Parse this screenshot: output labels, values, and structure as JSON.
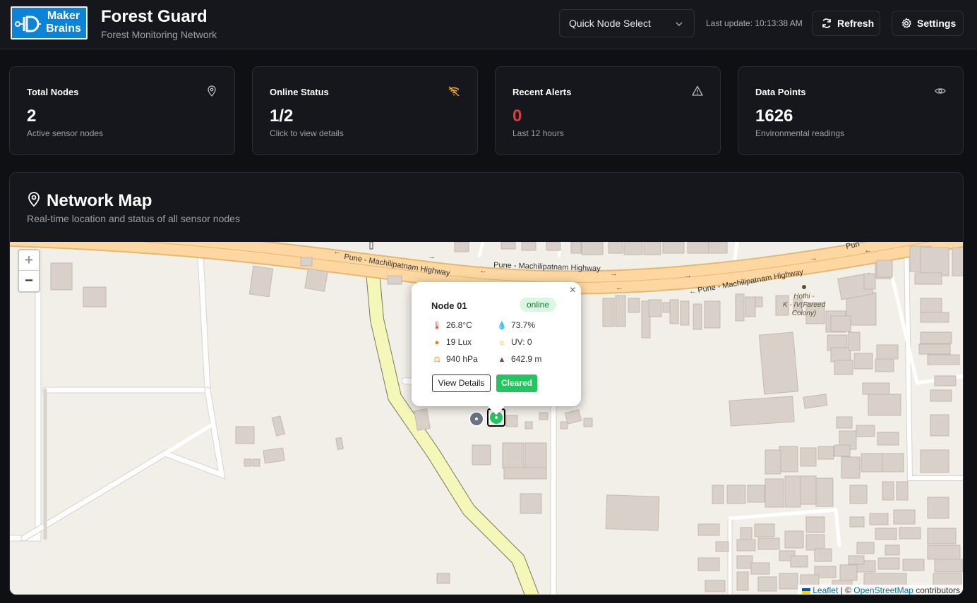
{
  "header": {
    "logo_line1": "Maker",
    "logo_line2": "Brains",
    "title": "Forest Guard",
    "subtitle": "Forest Monitoring Network",
    "quick_select": "Quick Node Select",
    "last_update": "Last update: 10:13:38 AM",
    "refresh_label": "Refresh",
    "settings_label": "Settings"
  },
  "cards": [
    {
      "title": "Total Nodes",
      "value": "2",
      "sub": "Active sensor nodes",
      "icon": "map-pin-icon"
    },
    {
      "title": "Online Status",
      "value": "1/2",
      "sub": "Click to view details",
      "icon": "wifi-off-icon"
    },
    {
      "title": "Recent Alerts",
      "value": "0",
      "sub": "Last 12 hours",
      "icon": "warning-icon"
    },
    {
      "title": "Data Points",
      "value": "1626",
      "sub": "Environmental readings",
      "icon": "eye-icon"
    }
  ],
  "colors": {
    "accent_warn": "#f5a623",
    "alert_value": "#e5393b",
    "online_green": "#22c55e",
    "offline_gray": "#6b7280",
    "logo_blue": "#0b83d9"
  },
  "map_section": {
    "title": "Network Map",
    "subtitle": "Real-time location and status of all sensor nodes",
    "zoom_in": "+",
    "zoom_out": "−",
    "roads": [
      "Pune - Machilipatnam Highway"
    ],
    "place_label": [
      "Hothi -",
      "K - IV(Fareed",
      "Colony)"
    ],
    "road_abbrev": "Pun",
    "attribution_leaflet": "Leaflet",
    "attribution_sep": " | © ",
    "attribution_osm": "OpenStreetMap",
    "attribution_tail": " contributors"
  },
  "popup": {
    "node_name": "Node 01",
    "status": "online",
    "temperature": "26.8°C",
    "humidity": "73.7%",
    "light": "19 Lux",
    "uv": "UV: 0",
    "pressure": "940 hPa",
    "altitude": "642.9 m",
    "view_label": "View Details",
    "cleared_label": "Cleared",
    "close": "×"
  }
}
